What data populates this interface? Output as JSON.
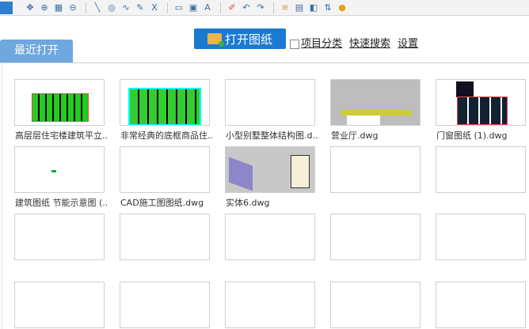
{
  "toolbar": {
    "icons": [
      "zoom-extents-icon",
      "zoom-window-icon",
      "zoom-select-icon",
      "zoom-out-icon",
      "|",
      "line-icon",
      "circle-icon",
      "spline-icon",
      "pencil-icon",
      "text-icon",
      "|",
      "rectangle-icon",
      "image-icon",
      "text-style-icon",
      "|",
      "eraser-icon",
      "undo-icon",
      "redo-icon",
      "|",
      "layer-icon",
      "block-icon",
      "3d-icon",
      "sort-icon",
      "color-icon"
    ]
  },
  "header": {
    "open_label": "打开图纸",
    "category_label": "项目分类",
    "search_label": "快速搜索",
    "settings_label": "设置"
  },
  "tab": {
    "label": "最近打开"
  },
  "files": [
    {
      "name": "高层层住宅楼建筑平立..",
      "thumb": "plan-green"
    },
    {
      "name": "非常经典的底框商品住..",
      "thumb": "plan-cyan"
    },
    {
      "name": "小型别墅整体结构图.d...",
      "thumb": "blank"
    },
    {
      "name": "营业厅.dwg",
      "thumb": "gray"
    },
    {
      "name": "门窗图纸 (1).dwg",
      "thumb": "dark"
    },
    {
      "name": "建筑图纸 节能示意图 (..",
      "thumb": "dot"
    },
    {
      "name": "CAD施工图图纸.dwg",
      "thumb": "blank"
    },
    {
      "name": "实体6.dwg",
      "thumb": "3d"
    },
    {
      "name": "",
      "thumb": "blank"
    },
    {
      "name": "",
      "thumb": "blank"
    },
    {
      "name": "",
      "thumb": "blank"
    },
    {
      "name": "",
      "thumb": "blank"
    },
    {
      "name": "",
      "thumb": "blank"
    },
    {
      "name": "",
      "thumb": "blank"
    },
    {
      "name": "",
      "thumb": "blank"
    },
    {
      "name": "",
      "thumb": "blank"
    },
    {
      "name": "",
      "thumb": "blank"
    },
    {
      "name": "",
      "thumb": "blank"
    },
    {
      "name": "",
      "thumb": "blank"
    },
    {
      "name": "",
      "thumb": "blank"
    }
  ]
}
